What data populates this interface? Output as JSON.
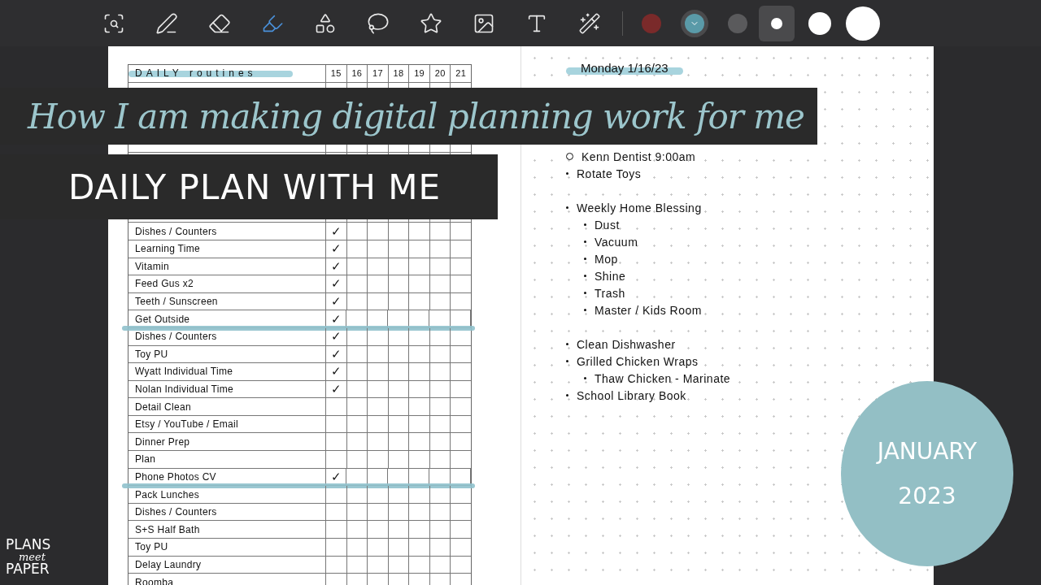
{
  "toolbar": {
    "tools": [
      {
        "selected": false
      },
      {
        "selected": false
      },
      {
        "selected": false
      },
      {
        "selected": true
      },
      {
        "selected": false
      },
      {
        "selected": false
      },
      {
        "selected": false
      },
      {
        "selected": false
      },
      {
        "selected": false
      },
      {
        "selected": false
      }
    ],
    "colors": [
      {
        "color": "#7a2a2a",
        "selected": false
      },
      {
        "color": "#5a9aa8",
        "selected": true
      },
      {
        "color": "#5a5a5c",
        "selected": false
      }
    ],
    "sizes": [
      {
        "selected": true
      },
      {
        "selected": false
      },
      {
        "selected": false
      }
    ]
  },
  "routines": {
    "title": "DAILY routines",
    "days": [
      "15",
      "16",
      "17",
      "18",
      "19",
      "20",
      "21"
    ],
    "rows": [
      {},
      {},
      {},
      {},
      {},
      {},
      {},
      {},
      {
        "label": "Dishes / Counters",
        "check": "✓"
      },
      {
        "label": "Learning Time",
        "check": "✓"
      },
      {
        "label": "Vitamin",
        "check": "✓"
      },
      {
        "label": "Feed Gus x2",
        "check": "✓"
      },
      {
        "label": "Teeth / Sunscreen",
        "check": "✓"
      },
      {
        "label": "Get Outside",
        "check": "✓",
        "highlight_below": true
      },
      {
        "label": "Dishes / Counters",
        "check": "✓"
      },
      {
        "label": "Toy PU",
        "check": "✓"
      },
      {
        "label": "Wyatt Individual Time",
        "check": "✓"
      },
      {
        "label": "Nolan Individual Time",
        "check": "✓"
      },
      {
        "label": "Detail Clean"
      },
      {
        "label": "Etsy / YouTube / Email"
      },
      {
        "label": "Dinner Prep"
      },
      {
        "label": "Plan"
      },
      {
        "label": "Phone Photos CV",
        "check": "✓",
        "highlight_below": true
      },
      {
        "label": "Pack Lunches"
      },
      {
        "label": "Dishes / Counters"
      },
      {
        "label": "S+S Half Bath"
      },
      {
        "label": "Toy PU"
      },
      {
        "label": "Delay Laundry"
      },
      {
        "label": "Roomba"
      }
    ]
  },
  "daily_notes": {
    "date": "Monday 1/16/23",
    "items": [
      {
        "kind": "circle",
        "text": "Kenn Dentist 9:00am"
      },
      {
        "kind": "dot",
        "text": "Rotate Toys"
      },
      {
        "kind": "gap"
      },
      {
        "kind": "dot",
        "text": "Weekly Home Blessing",
        "children": [
          {
            "kind": "dot",
            "text": "Dust"
          },
          {
            "kind": "dot",
            "text": "Vacuum"
          },
          {
            "kind": "dot",
            "text": "Mop"
          },
          {
            "kind": "dot",
            "text": "Shine"
          },
          {
            "kind": "dot",
            "text": "Trash"
          },
          {
            "kind": "dot",
            "text": "Master / Kids Room"
          }
        ]
      },
      {
        "kind": "gap"
      },
      {
        "kind": "dot",
        "text": "Clean Dishwasher"
      },
      {
        "kind": "dot",
        "text": "Grilled Chicken Wraps",
        "children": [
          {
            "kind": "dot",
            "text": "Thaw Chicken - Marinate"
          }
        ]
      },
      {
        "kind": "dot",
        "text": "School Library Book"
      }
    ]
  },
  "banners": [
    {
      "kind": "script",
      "text": "How I am making digital planning work for me"
    },
    {
      "kind": "caps",
      "text": "DAILY PLAN WITH ME"
    }
  ],
  "month_badge": {
    "month": "JANUARY",
    "year": "2023"
  },
  "logo": {
    "lines": [
      "PLANS",
      "meet",
      "PAPER"
    ]
  }
}
